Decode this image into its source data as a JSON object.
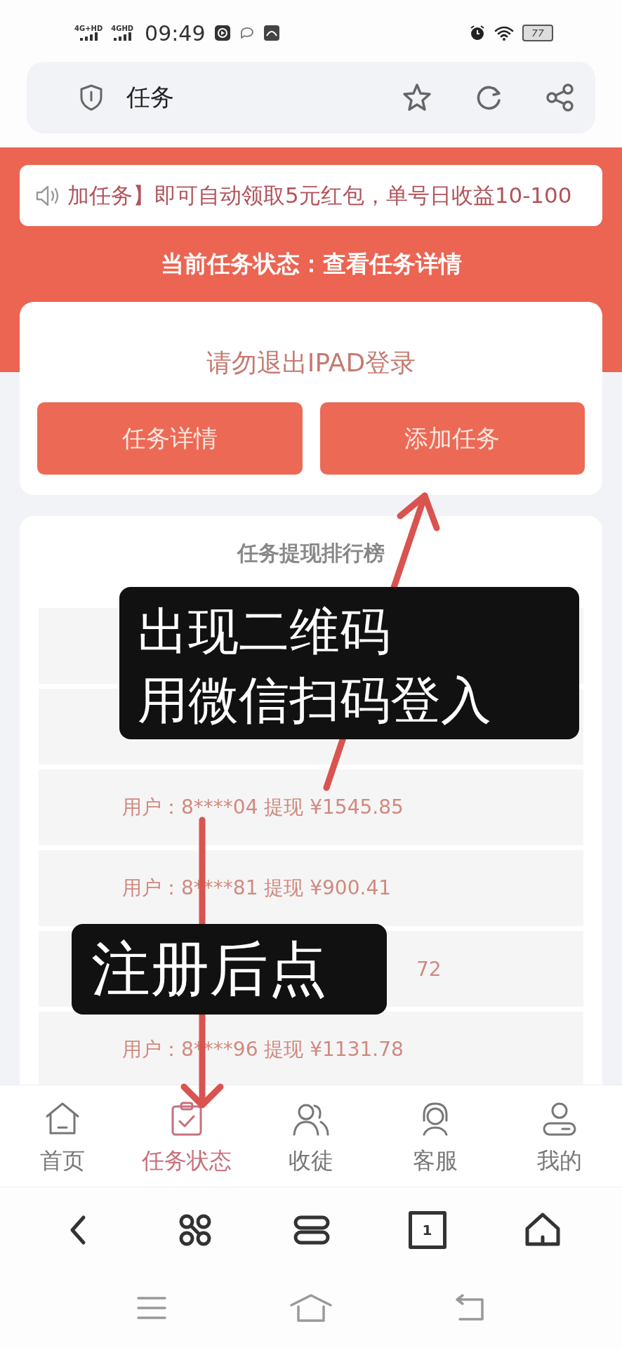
{
  "status_bar": {
    "networks": [
      "4G+HD",
      "4GHD"
    ],
    "time": "09:49",
    "battery": "77"
  },
  "address_bar": {
    "title": "任务"
  },
  "notice": {
    "text": "加任务】即可自动领取5元红包，单号日收益10-100"
  },
  "task_status": {
    "text": "当前任务状态：查看任务详情"
  },
  "task_card": {
    "message": "请勿退出IPAD登录",
    "buttons": [
      "任务详情",
      "添加任务"
    ]
  },
  "leaderboard": {
    "title": "任务提现排行榜",
    "rows": [
      {
        "kind": "blank"
      },
      {
        "kind": "blank"
      },
      {
        "kind": "full",
        "text": "用户：8****04 提现 ¥1545.85"
      },
      {
        "kind": "full",
        "text": "用户：8****81 提现 ¥900.41"
      },
      {
        "kind": "partial",
        "text": "72"
      },
      {
        "kind": "full",
        "text": "用户：8****96 提现 ¥1131.78"
      }
    ]
  },
  "bottom_nav": [
    {
      "label": "首页",
      "selected": false
    },
    {
      "label": "任务状态",
      "selected": true
    },
    {
      "label": "收徒",
      "selected": false
    },
    {
      "label": "客服",
      "selected": false
    },
    {
      "label": "我的",
      "selected": false
    }
  ],
  "browser_toolbar": {
    "tab_count": "1"
  },
  "annotations": [
    {
      "kind": "label",
      "lines": [
        "出现二维码",
        "用微信扫码登入"
      ]
    },
    {
      "kind": "label",
      "lines": [
        "注册后点"
      ]
    },
    {
      "kind": "arrow"
    },
    {
      "kind": "arrow"
    }
  ]
}
